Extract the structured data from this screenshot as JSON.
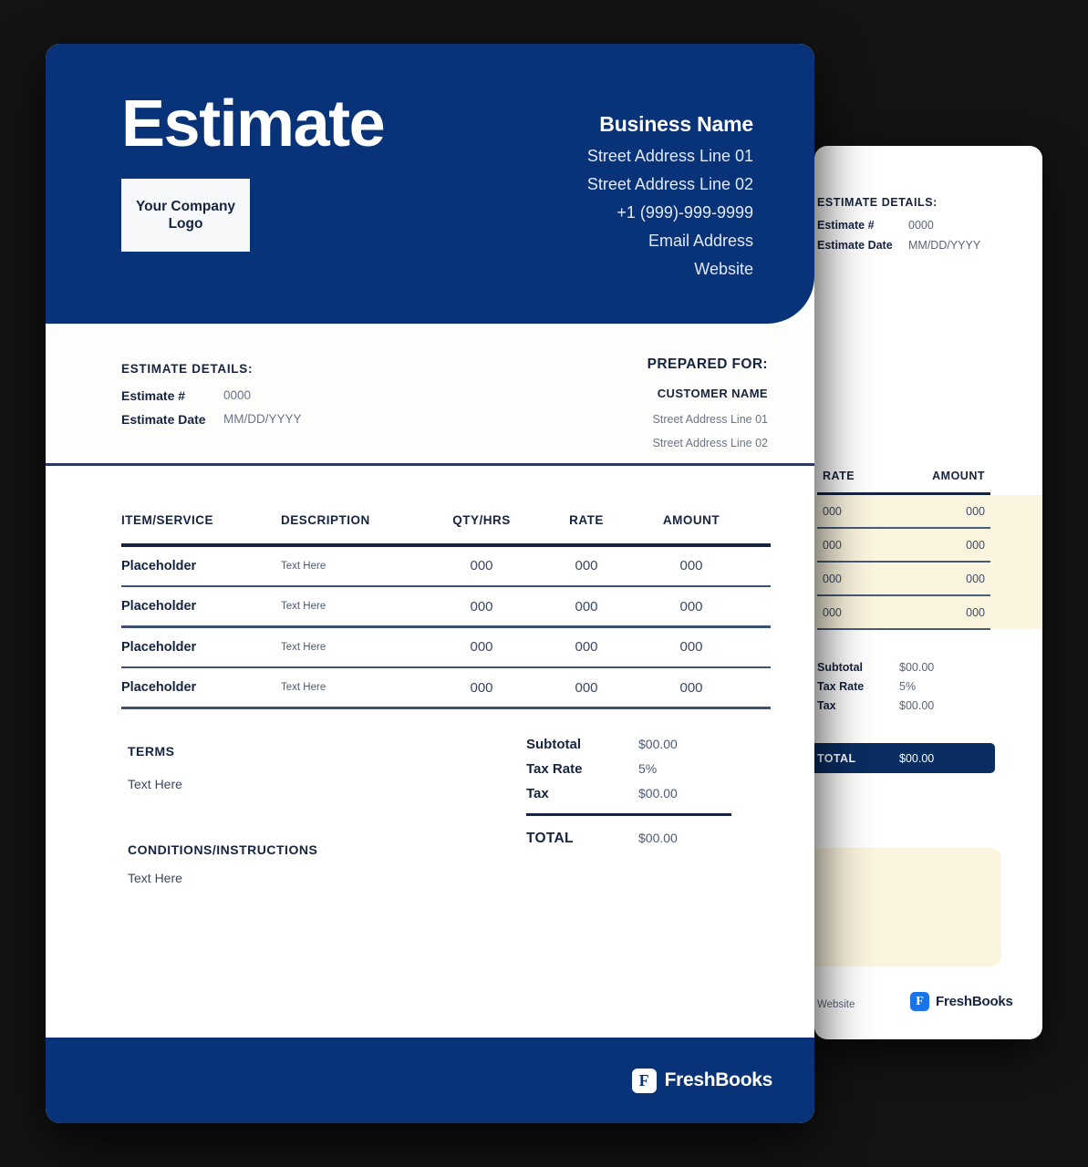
{
  "theme": {
    "navy": "#083378",
    "ink": "#16243f",
    "muted": "#6a7486",
    "cream": "#fbf4df",
    "page_bg": "#141414",
    "fb_blue": "#1a73e8"
  },
  "page1": {
    "header": {
      "title": "Estimate",
      "logo_placeholder": "Your Company Logo",
      "business": {
        "name": "Business Name",
        "lines": [
          "Street Address Line 01",
          "Street Address Line 02",
          "+1 (999)-999-9999",
          "Email Address",
          "Website"
        ]
      }
    },
    "details": {
      "title": "ESTIMATE DETAILS:",
      "rows": [
        {
          "key": "Estimate #",
          "value": "0000"
        },
        {
          "key": "Estimate Date",
          "value": "MM/DD/YYYY"
        }
      ]
    },
    "prepared_for": {
      "title": "PREPARED FOR:",
      "customer_name": "CUSTOMER NAME",
      "lines": [
        "Street Address Line 01",
        "Street Address Line 02"
      ]
    },
    "items_table": {
      "headers": [
        "ITEM/SERVICE",
        "DESCRIPTION",
        "QTY/HRS",
        "RATE",
        "AMOUNT"
      ],
      "rows": [
        {
          "item": "Placeholder",
          "description": "Text Here",
          "qty": "000",
          "rate": "000",
          "amount": "000"
        },
        {
          "item": "Placeholder",
          "description": "Text Here",
          "qty": "000",
          "rate": "000",
          "amount": "000"
        },
        {
          "item": "Placeholder",
          "description": "Text Here",
          "qty": "000",
          "rate": "000",
          "amount": "000"
        },
        {
          "item": "Placeholder",
          "description": "Text Here",
          "qty": "000",
          "rate": "000",
          "amount": "000"
        }
      ]
    },
    "terms": {
      "title": "TERMS",
      "text": "Text Here"
    },
    "totals": {
      "rows": [
        {
          "key": "Subtotal",
          "value": "$00.00"
        },
        {
          "key": "Tax Rate",
          "value": "5%"
        },
        {
          "key": "Tax",
          "value": "$00.00"
        }
      ],
      "grand": {
        "key": "TOTAL",
        "value": "$00.00"
      }
    },
    "conditions": {
      "title": "CONDITIONS/INSTRUCTIONS",
      "text": "Text Here"
    },
    "footer": {
      "brand_mark": "F",
      "brand_name": "FreshBooks"
    }
  },
  "page2": {
    "details": {
      "title": "ESTIMATE DETAILS:",
      "rows": [
        {
          "key": "Estimate #",
          "value": "0000"
        },
        {
          "key": "Estimate Date",
          "value": "MM/DD/YYYY"
        }
      ]
    },
    "items_table": {
      "headers": [
        "RATE",
        "AMOUNT"
      ],
      "rows": [
        {
          "rate": "000",
          "amount": "000"
        },
        {
          "rate": "000",
          "amount": "000"
        },
        {
          "rate": "000",
          "amount": "000"
        },
        {
          "rate": "000",
          "amount": "000"
        }
      ]
    },
    "totals": {
      "rows": [
        {
          "key": "Subtotal",
          "value": "$00.00"
        },
        {
          "key": "Tax Rate",
          "value": "5%"
        },
        {
          "key": "Tax",
          "value": "$00.00"
        }
      ],
      "grand": {
        "key": "TOTAL",
        "value": "$00.00"
      }
    },
    "footer": {
      "website": "Website",
      "brand_mark": "F",
      "brand_name": "FreshBooks"
    }
  }
}
